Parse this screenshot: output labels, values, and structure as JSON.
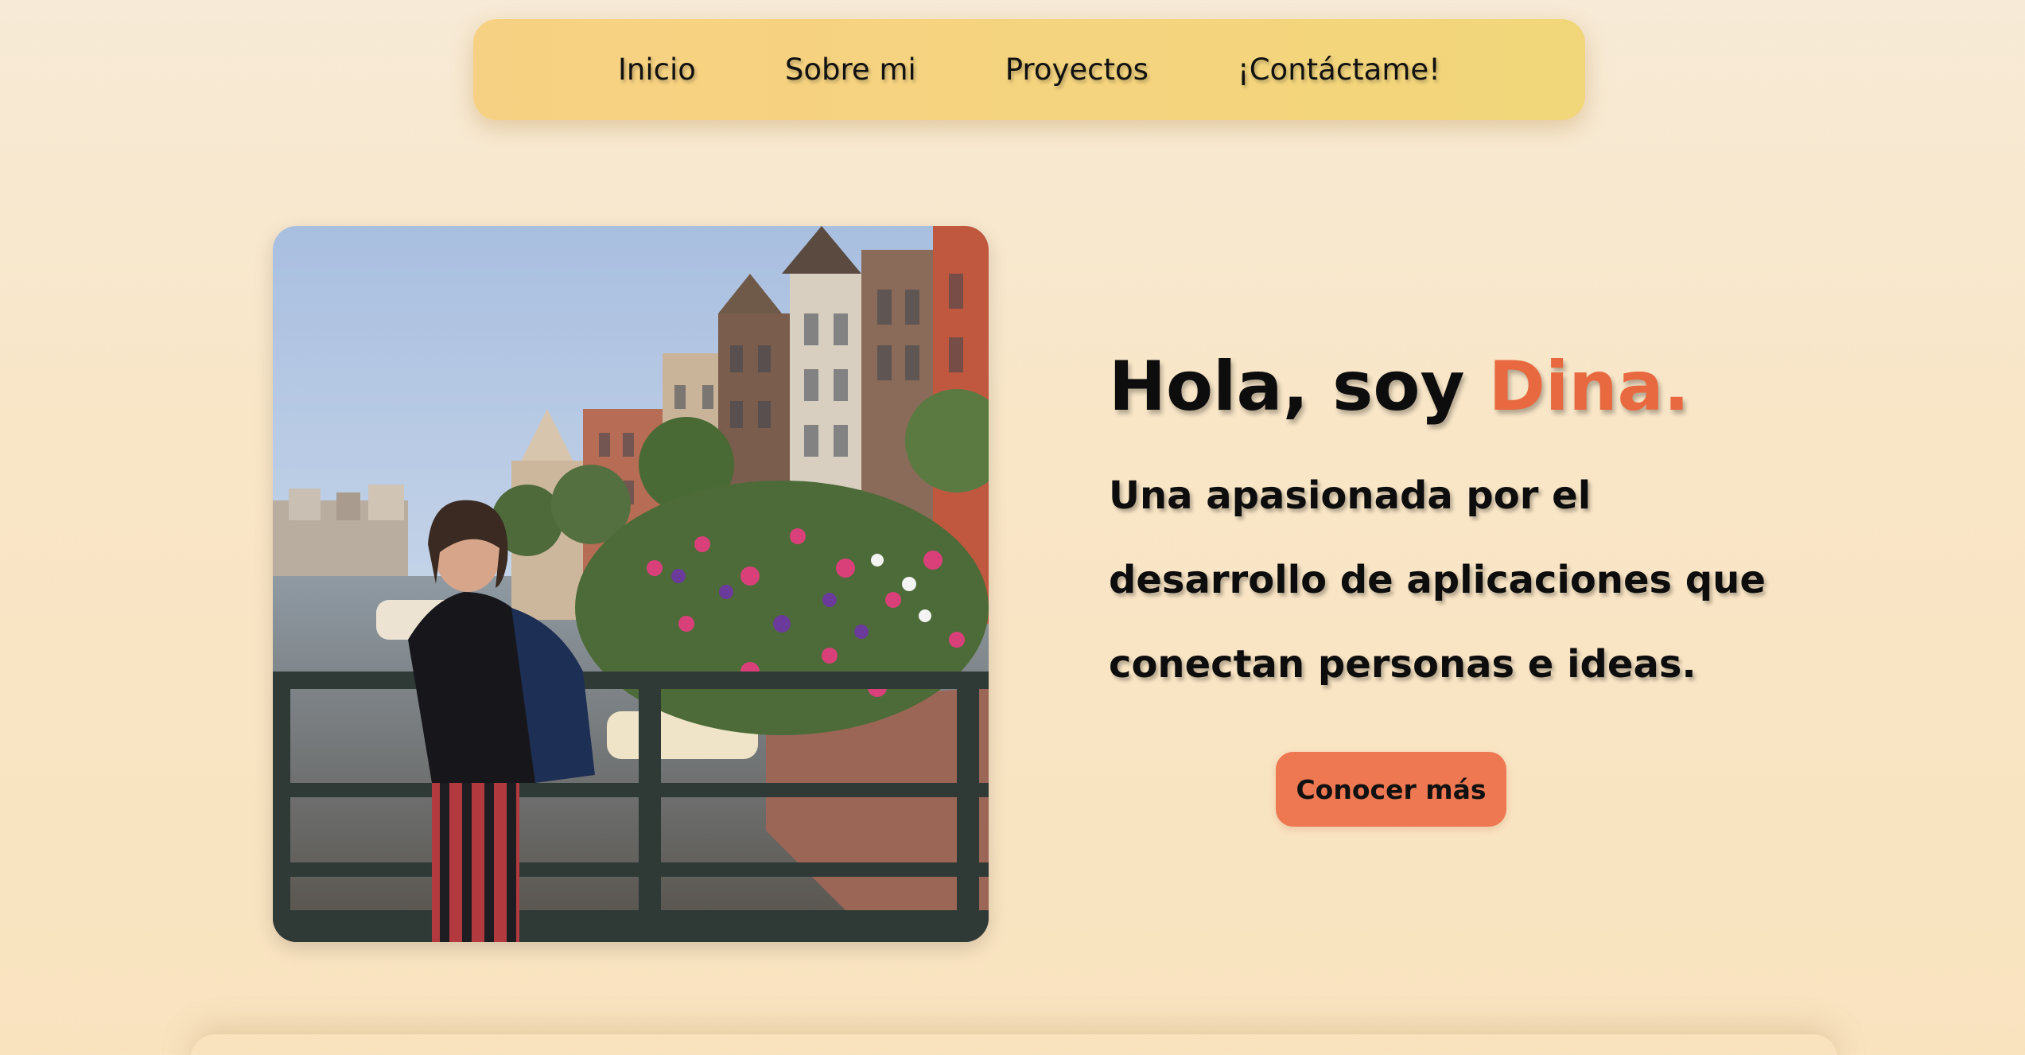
{
  "nav": {
    "items": [
      {
        "label": "Inicio"
      },
      {
        "label": "Sobre mi"
      },
      {
        "label": "Proyectos"
      },
      {
        "label": "¡Contáctame!"
      }
    ]
  },
  "hero": {
    "greeting": "Hola, soy ",
    "name": "Dina.",
    "subtitle_lines": [
      "Una apasionada por el",
      "desarrollo de aplicaciones que",
      "conectan personas e ideas."
    ],
    "button_label": "Conocer más",
    "photo_icon": "profile-photo"
  },
  "colors": {
    "accent": "#e8693f",
    "button": "#ee7852",
    "nav_background": "#f4d47e",
    "page_background": "#f9e6c7"
  }
}
